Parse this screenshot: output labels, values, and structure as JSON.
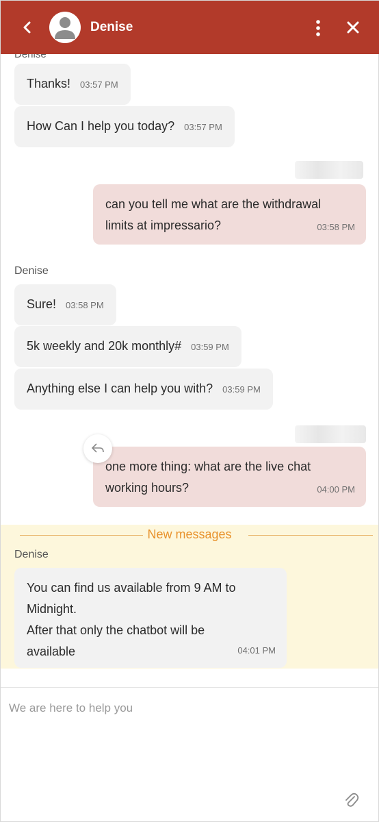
{
  "header": {
    "agent_name": "Denise",
    "accent_color": "#b23a2a",
    "icons": [
      "chevron-left-icon",
      "avatar-user-icon",
      "more-vertical-icon",
      "close-icon"
    ]
  },
  "conversation": {
    "cut_sender": "Denise",
    "group1": [
      {
        "text": "Thanks!",
        "time": "03:57 PM"
      },
      {
        "text": "How Can I help you today?",
        "time": "03:57 PM"
      }
    ],
    "user1": {
      "text": "can you tell me what are the withdrawal limits at impressario?",
      "time": "03:58 PM"
    },
    "sender2": "Denise",
    "group2": [
      {
        "text": "Sure!",
        "time": "03:58 PM"
      },
      {
        "text": "5k weekly and 20k monthly#",
        "time": "03:59 PM"
      },
      {
        "text": "Anything else I can help you with?",
        "time": "03:59 PM"
      }
    ],
    "user2": {
      "text": "one more thing: what are the live chat working hours?",
      "time": "04:00 PM"
    },
    "new_messages_label": "New messages",
    "sender3": "Denise",
    "latest": {
      "line1": "You can find us available from 9 AM to Midnight.",
      "line2": "After that only the chatbot will be available",
      "time": "04:01 PM"
    }
  },
  "composer": {
    "placeholder": "We are here to help you",
    "value": ""
  }
}
